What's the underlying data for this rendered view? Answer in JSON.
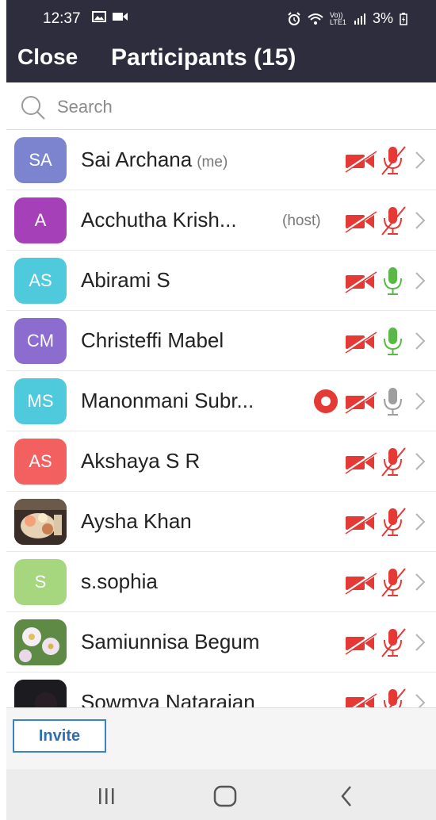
{
  "status": {
    "time": "12:37",
    "battery": "3%",
    "network": "Vo)) LTE1"
  },
  "header": {
    "close_label": "Close",
    "title": "Participants (15)"
  },
  "search": {
    "placeholder": "Search"
  },
  "colors": {
    "header_bg": "#2d2d3d",
    "muted_red": "#e53935",
    "unmuted_green": "#5ab946",
    "gray_mic": "#9e9e9e",
    "invite_blue": "#2e6fb0"
  },
  "participants": [
    {
      "initials": "SA",
      "name": "Sai Archana",
      "tag": "(me)",
      "avatar_color": "#7d84cf",
      "video": "off",
      "mic": "muted"
    },
    {
      "initials": "A",
      "name": "Acchutha Krish...",
      "tag": "(host)",
      "avatar_color": "#a640b9",
      "video": "off",
      "mic": "muted"
    },
    {
      "initials": "AS",
      "name": "Abirami S",
      "tag": "",
      "avatar_color": "#4fcadc",
      "video": "off",
      "mic": "green"
    },
    {
      "initials": "CM",
      "name": "Christeffi Mabel",
      "tag": "",
      "avatar_color": "#8d6cd0",
      "video": "off",
      "mic": "green"
    },
    {
      "initials": "MS",
      "name": "Manonmani Subr...",
      "tag": "",
      "avatar_color": "#4fcadc",
      "video": "off",
      "mic": "gray",
      "recording": true
    },
    {
      "initials": "AS",
      "name": "Akshaya S R",
      "tag": "",
      "avatar_color": "#f26160",
      "video": "off",
      "mic": "muted"
    },
    {
      "initials": "",
      "name": "Aysha Khan",
      "tag": "",
      "avatar_color": "#3a2c26",
      "video": "off",
      "mic": "muted",
      "photo": "food"
    },
    {
      "initials": "S",
      "name": "s.sophia",
      "tag": "",
      "avatar_color": "#a6d67e",
      "video": "off",
      "mic": "muted"
    },
    {
      "initials": "",
      "name": "Samiunnisa Begum",
      "tag": "",
      "avatar_color": "#6a8f4c",
      "video": "off",
      "mic": "muted",
      "photo": "flowers"
    },
    {
      "initials": "",
      "name": "Sowmya Natarajan",
      "tag": "",
      "avatar_color": "#1b1b20",
      "video": "off",
      "mic": "muted",
      "photo": "dark"
    }
  ],
  "footer": {
    "invite_label": "Invite"
  }
}
